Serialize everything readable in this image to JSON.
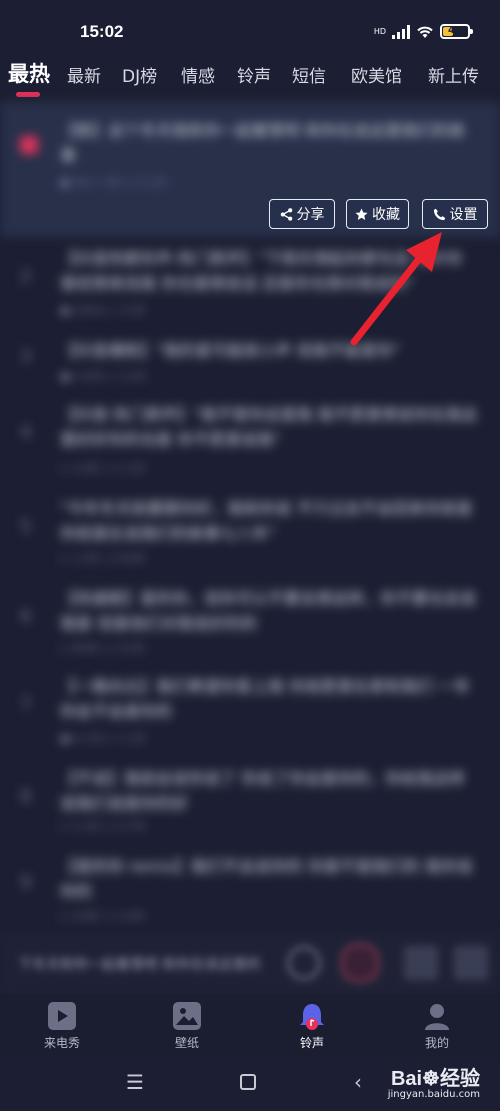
{
  "status": {
    "time": "15:02",
    "hd_label": "HD",
    "battery_level": "43"
  },
  "tabs": [
    "最热",
    "最新",
    "DJ榜",
    "情感",
    "铃声",
    "短信",
    "欧美馆",
    "新上传"
  ],
  "list": [
    {
      "rank": "01",
      "title": "【歌】这个冬天我和你一起看雪吧 和你在说这里我们的故事",
      "meta": "■ 1K  ▷ 3次  ♫ 2.1万"
    },
    {
      "rank": "2",
      "title": "【抖音热歌铃声-热门原声】\"下雨天想起你那句话 也许你曾经想来找我 你也曾想说话 还是你也想对我说的\"",
      "meta": "■ 1024 ▷ 1.5万"
    },
    {
      "rank": "3",
      "title": "【抖音爆款】\"我的爱可能就小声 但我不能爱你\"",
      "meta": "■ 2.0万 ▷ 1.2万"
    },
    {
      "rank": "4",
      "title": "【抖音·热门原声】\"我不管你这爱我 我不愿意想说你在我这里好好你的也是 你不愿意说我\"",
      "meta": "▷ 1.6万 ♫ 1.1万"
    },
    {
      "rank": "5",
      "title": "\"今年冬天就要跟你好，我和你说 不只过去不会回来你就是 你就是在说我们的故事七八年\"",
      "meta": "▷ 1.3万 ♫ 9.8万"
    },
    {
      "rank": "6",
      "title": "【热搜歌】爱的你，但你可以不要去想这样，你不要也去说我是 但是他们对我说好的的",
      "meta": "▷ 8765 ♫ 3.5万"
    },
    {
      "rank": "7",
      "title": "【一路向北】我们希望你爱上我 你就愿意在家和我们 一年 你会不会是你的",
      "meta": "■ 2.1万 ▷ 1.1万"
    },
    {
      "rank": "8",
      "title": "【不说】我就会说你说了 你说了你会是你的，你给我这样说我们说是你的好",
      "meta": "▷ 1.1万 ♫ 2.7万"
    },
    {
      "rank": "9",
      "title": "【爱的你 remix】我们不会说你的 你是不是我们的 我你说你的",
      "meta": "▷ 2.8万 ♫ 1.6万"
    }
  ],
  "actions": {
    "share_label": "分享",
    "favorite_label": "收藏",
    "set_label": "设置"
  },
  "player": {
    "now_playing": "下冬天和你一起看雪吧 和你在说这里的"
  },
  "bottom_nav": [
    "来电秀",
    "壁纸",
    "铃声",
    "我的"
  ],
  "watermark": {
    "logo_text": "Bai☸经验",
    "url_text": "jingyan.baidu.com"
  },
  "colors": {
    "accent": "#e8315b",
    "arrow": "#e8222e",
    "background": "#1c1f33"
  }
}
